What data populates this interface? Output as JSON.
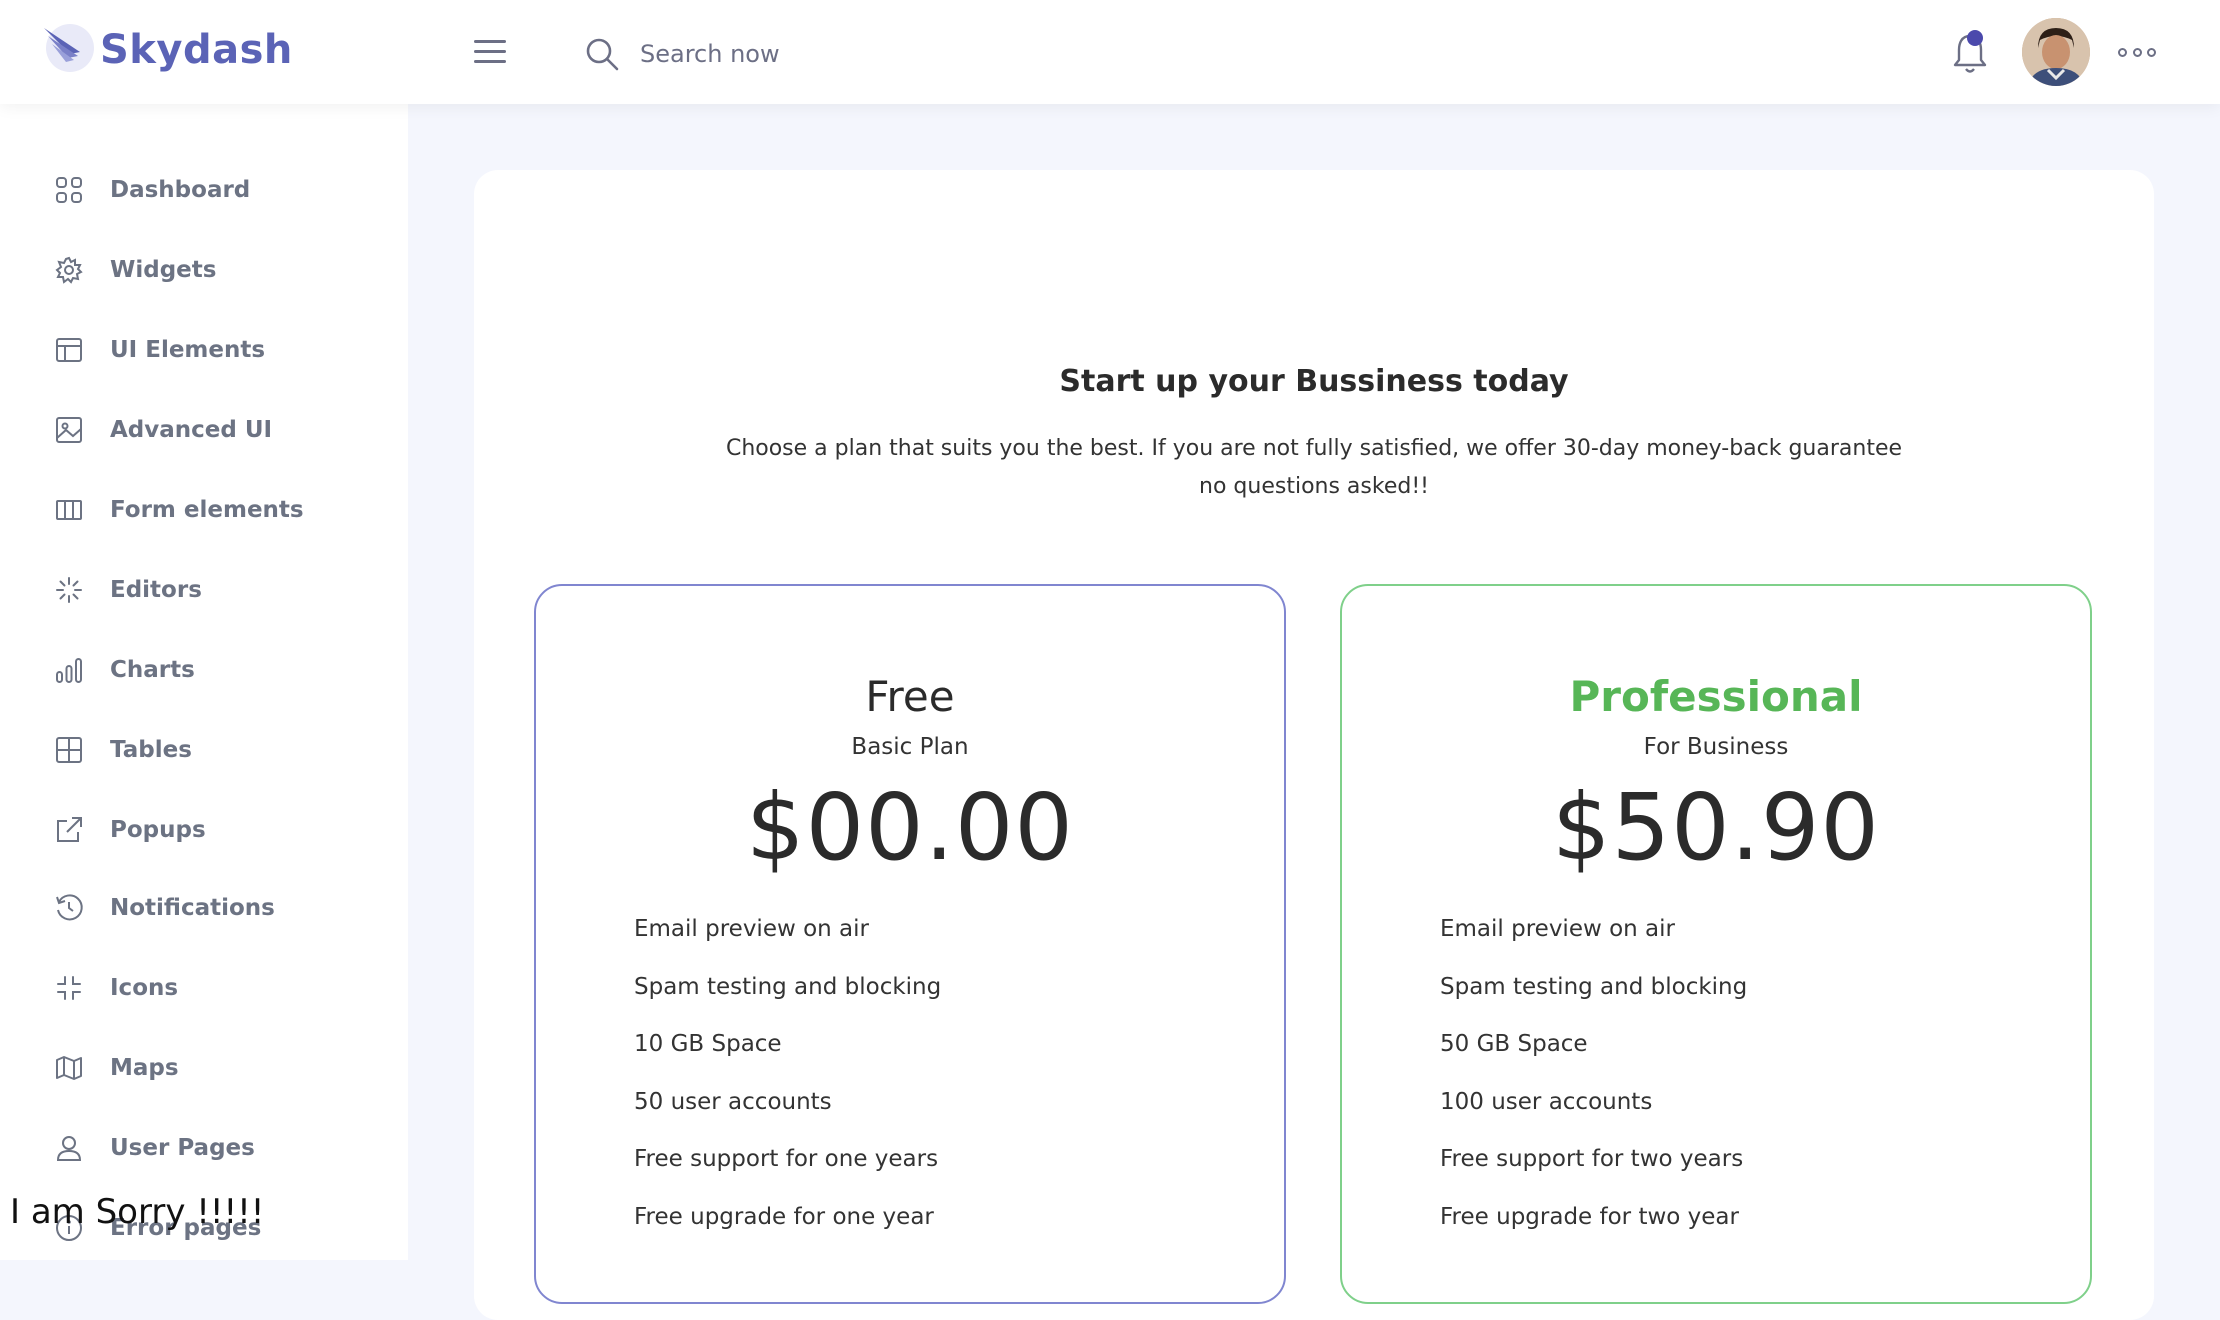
{
  "brand": {
    "name": "Skydash"
  },
  "search": {
    "placeholder": "Search now"
  },
  "sidebar": {
    "items": [
      {
        "label": "Dashboard",
        "icon": "grid-icon"
      },
      {
        "label": "Widgets",
        "icon": "gear-icon"
      },
      {
        "label": "UI Elements",
        "icon": "layout-icon"
      },
      {
        "label": "Advanced UI",
        "icon": "image-icon"
      },
      {
        "label": "Form elements",
        "icon": "columns-icon"
      },
      {
        "label": "Editors",
        "icon": "loader-icon"
      },
      {
        "label": "Charts",
        "icon": "bar-chart-icon"
      },
      {
        "label": "Tables",
        "icon": "table-icon"
      },
      {
        "label": "Popups",
        "icon": "external-link-icon"
      },
      {
        "label": "Notifications",
        "icon": "history-icon"
      },
      {
        "label": "Icons",
        "icon": "shrink-icon"
      },
      {
        "label": "Maps",
        "icon": "map-icon"
      },
      {
        "label": "User Pages",
        "icon": "user-icon"
      },
      {
        "label": "Error pages",
        "icon": "info-icon"
      }
    ]
  },
  "pricing": {
    "headline": "Start up your Bussiness today",
    "subline": "Choose a plan that suits you the best. If you are not fully satisfied, we offer 30-day money-back guarantee no questions asked!!",
    "plans": [
      {
        "name": "Free",
        "subtitle": "Basic Plan",
        "price": "$00.00",
        "features": [
          "Email preview on air",
          "Spam testing and blocking",
          "10 GB Space",
          "50 user accounts",
          "Free support for one years",
          "Free upgrade for one year"
        ]
      },
      {
        "name": "Professional",
        "subtitle": "For Business",
        "price": "$50.90",
        "features": [
          "Email preview on air",
          "Spam testing and blocking",
          "50 GB Space",
          "100 user accounts",
          "Free support for two years",
          "Free upgrade for two year"
        ]
      }
    ]
  },
  "overlay": {
    "text": "I am Sorry !!!!!"
  },
  "colors": {
    "brand": "#5b63b6",
    "accent": "#4b49ac",
    "pro": "#57b657",
    "free_border": "#8086d0",
    "pro_border": "#7fd08a"
  }
}
